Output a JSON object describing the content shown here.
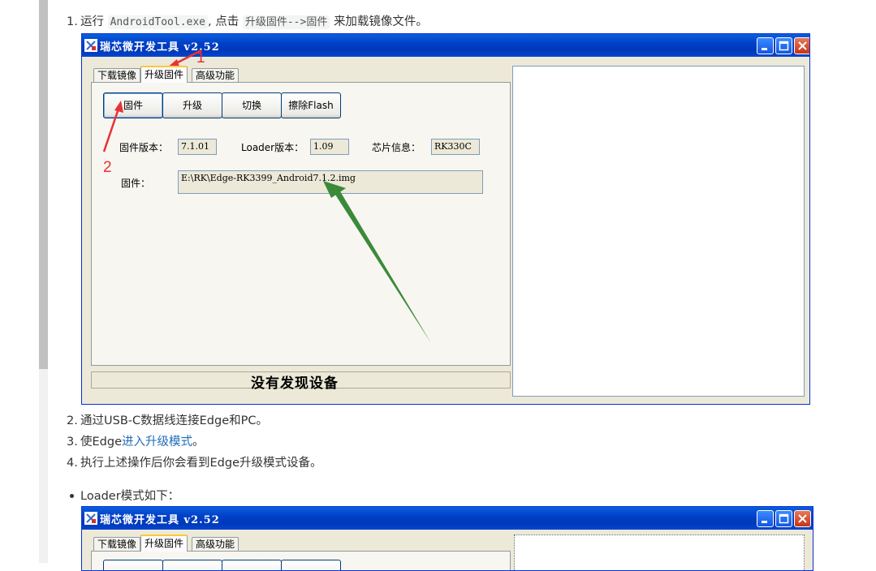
{
  "steps": [
    {
      "num": "1.",
      "pre": "运行",
      "code1": "AndroidTool.exe",
      "mid": ", 点击",
      "code2": "升级固件-->固件",
      "post": "来加载镜像文件。"
    },
    {
      "num": "2.",
      "text": "通过USB-C数据线连接Edge和PC。"
    },
    {
      "num": "3.",
      "pre": "使Edge",
      "link": "进入升级模式",
      "post": "。"
    },
    {
      "num": "4.",
      "text": "执行上述操作后你会看到Edge升级模式设备。"
    }
  ],
  "bullet_text": "Loader模式如下：",
  "window": {
    "title": "瑞芯微开发工具 v2.52",
    "tabs": [
      "下载镜像",
      "升级固件",
      "高级功能"
    ],
    "buttons": [
      "固件",
      "升级",
      "切换",
      "擦除Flash"
    ],
    "fields": [
      {
        "label": "固件版本：",
        "value": "7.1.01"
      },
      {
        "label": "Loader版本：",
        "value": "1.09"
      },
      {
        "label": "芯片信息：",
        "value": "RK330C"
      }
    ],
    "firmware_label": "固件：",
    "firmware_path": "E:\\RK\\Edge-RK3399_Android7.1.2.img",
    "status": "没有发现设备"
  },
  "annotations": [
    "1",
    "2"
  ],
  "colors": {
    "titlebar": "#0046d0",
    "window_bg": "#ece9d8",
    "annotation_red": "#e53333",
    "annotation_green": "#3a8a3a",
    "link": "#1e6bb8"
  },
  "icons": [
    "app-icon",
    "minimize-icon",
    "maximize-icon",
    "close-icon"
  ]
}
